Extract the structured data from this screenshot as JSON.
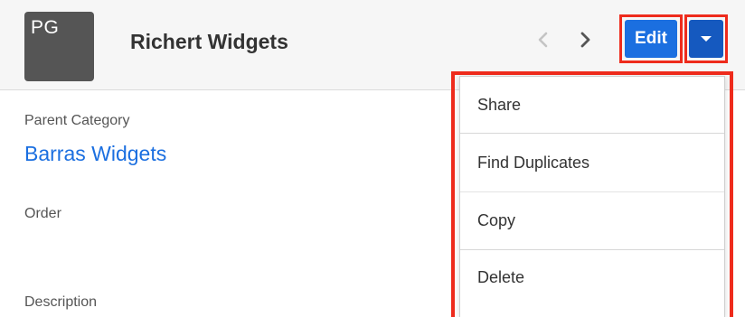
{
  "header": {
    "avatar_initials": "PG",
    "record_title": "Richert Widgets",
    "prev_icon": "chevron-left-icon",
    "next_icon": "chevron-right-icon",
    "edit_label": "Edit",
    "actions_icon": "caret-down-icon"
  },
  "fields": {
    "parent_category_label": "Parent Category",
    "parent_category_value": "Barras Widgets",
    "order_label": "Order",
    "description_label": "Description"
  },
  "actions_menu": {
    "items": [
      {
        "label": "Share"
      },
      {
        "label": "Find Duplicates"
      },
      {
        "label": "Copy"
      },
      {
        "label": "Delete"
      }
    ]
  },
  "colors": {
    "primary_button": "#1b6fe0",
    "dropdown_button": "#1559bf",
    "highlight_outline": "#ee2b1c",
    "link": "#1b6fe0"
  }
}
